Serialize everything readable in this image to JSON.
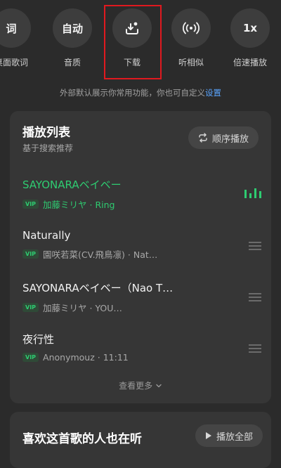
{
  "functions": [
    {
      "icon_text": "词",
      "label": "桌面歌词",
      "icon": "lyrics-icon"
    },
    {
      "icon_text": "自动",
      "label": "音质",
      "icon": "quality-icon"
    },
    {
      "icon_text": "",
      "label": "下载",
      "icon": "download-icon"
    },
    {
      "icon_text": "",
      "label": "听相似",
      "icon": "broadcast-icon"
    },
    {
      "icon_text": "1x",
      "label": "倍速播放",
      "icon": "speed-icon"
    }
  ],
  "hint": {
    "text": "外部默认展示你常用功能，你也可自定义",
    "link": "设置"
  },
  "playlist": {
    "title": "播放列表",
    "subtitle": "基于搜索推荐",
    "mode_label": "顺序播放",
    "songs": [
      {
        "title": "SAYONARAベイベー",
        "badge": "VIP",
        "meta": "加藤ミリヤ · Ring",
        "playing": true
      },
      {
        "title": "Naturally",
        "badge": "VIP",
        "meta": "園咲若菜(CV.飛鳥凛) · Nat…",
        "playing": false
      },
      {
        "title": "SAYONARAベイベー（Nao T…",
        "badge": "VIP",
        "meta": "加藤ミリヤ · YOU…",
        "playing": false
      },
      {
        "title": "夜行性",
        "badge": "VIP",
        "meta": "Anonymouz · 11:11",
        "playing": false
      }
    ],
    "more_label": "查看更多"
  },
  "recommend": {
    "title": "喜欢这首歌的人也在听",
    "play_all_label": "播放全部"
  },
  "colors": {
    "accent_green": "#2ecc71",
    "link_blue": "#5aa5ff",
    "highlight_red": "#e0191f"
  }
}
